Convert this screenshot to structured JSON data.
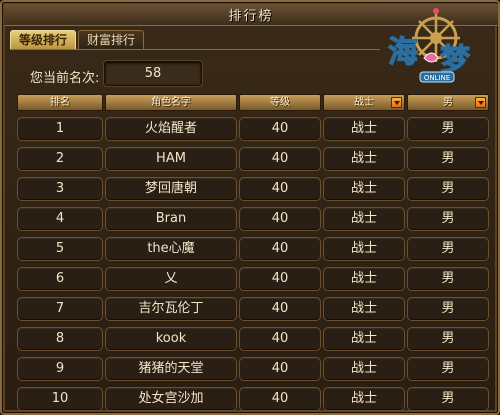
{
  "window": {
    "title": "排行榜"
  },
  "tabs": [
    {
      "label": "等级排行",
      "active": true
    },
    {
      "label": "财富排行",
      "active": false
    }
  ],
  "current_rank": {
    "label": "您当前名次:",
    "value": "58"
  },
  "columns": {
    "rank": "排名",
    "name": "角色名字",
    "level": "等级",
    "class_filter": "战士",
    "gender_filter": "男"
  },
  "rows": [
    {
      "rank": "1",
      "name": "火焰醒者",
      "level": "40",
      "class": "战士",
      "gender": "男"
    },
    {
      "rank": "2",
      "name": "HAM",
      "level": "40",
      "class": "战士",
      "gender": "男"
    },
    {
      "rank": "3",
      "name": "梦回唐朝",
      "level": "40",
      "class": "战士",
      "gender": "男"
    },
    {
      "rank": "4",
      "name": "Bran",
      "level": "40",
      "class": "战士",
      "gender": "男"
    },
    {
      "rank": "5",
      "name": "the心魔",
      "level": "40",
      "class": "战士",
      "gender": "男"
    },
    {
      "rank": "6",
      "name": "乂",
      "level": "40",
      "class": "战士",
      "gender": "男"
    },
    {
      "rank": "7",
      "name": "吉尔瓦伦丁",
      "level": "40",
      "class": "战士",
      "gender": "男"
    },
    {
      "rank": "8",
      "name": "kook",
      "level": "40",
      "class": "战士",
      "gender": "男"
    },
    {
      "rank": "9",
      "name": "猪猪的天堂",
      "level": "40",
      "class": "战士",
      "gender": "男"
    },
    {
      "rank": "10",
      "name": "处女宫沙加",
      "level": "40",
      "class": "战士",
      "gender": "男"
    }
  ],
  "logo": {
    "text": "海之梦",
    "subtext": "ONLINE"
  },
  "colors": {
    "accent": "#e8cf7a",
    "panel": "#2a1f14",
    "header": "#c89f5a",
    "dropdown": "#f08a20"
  }
}
